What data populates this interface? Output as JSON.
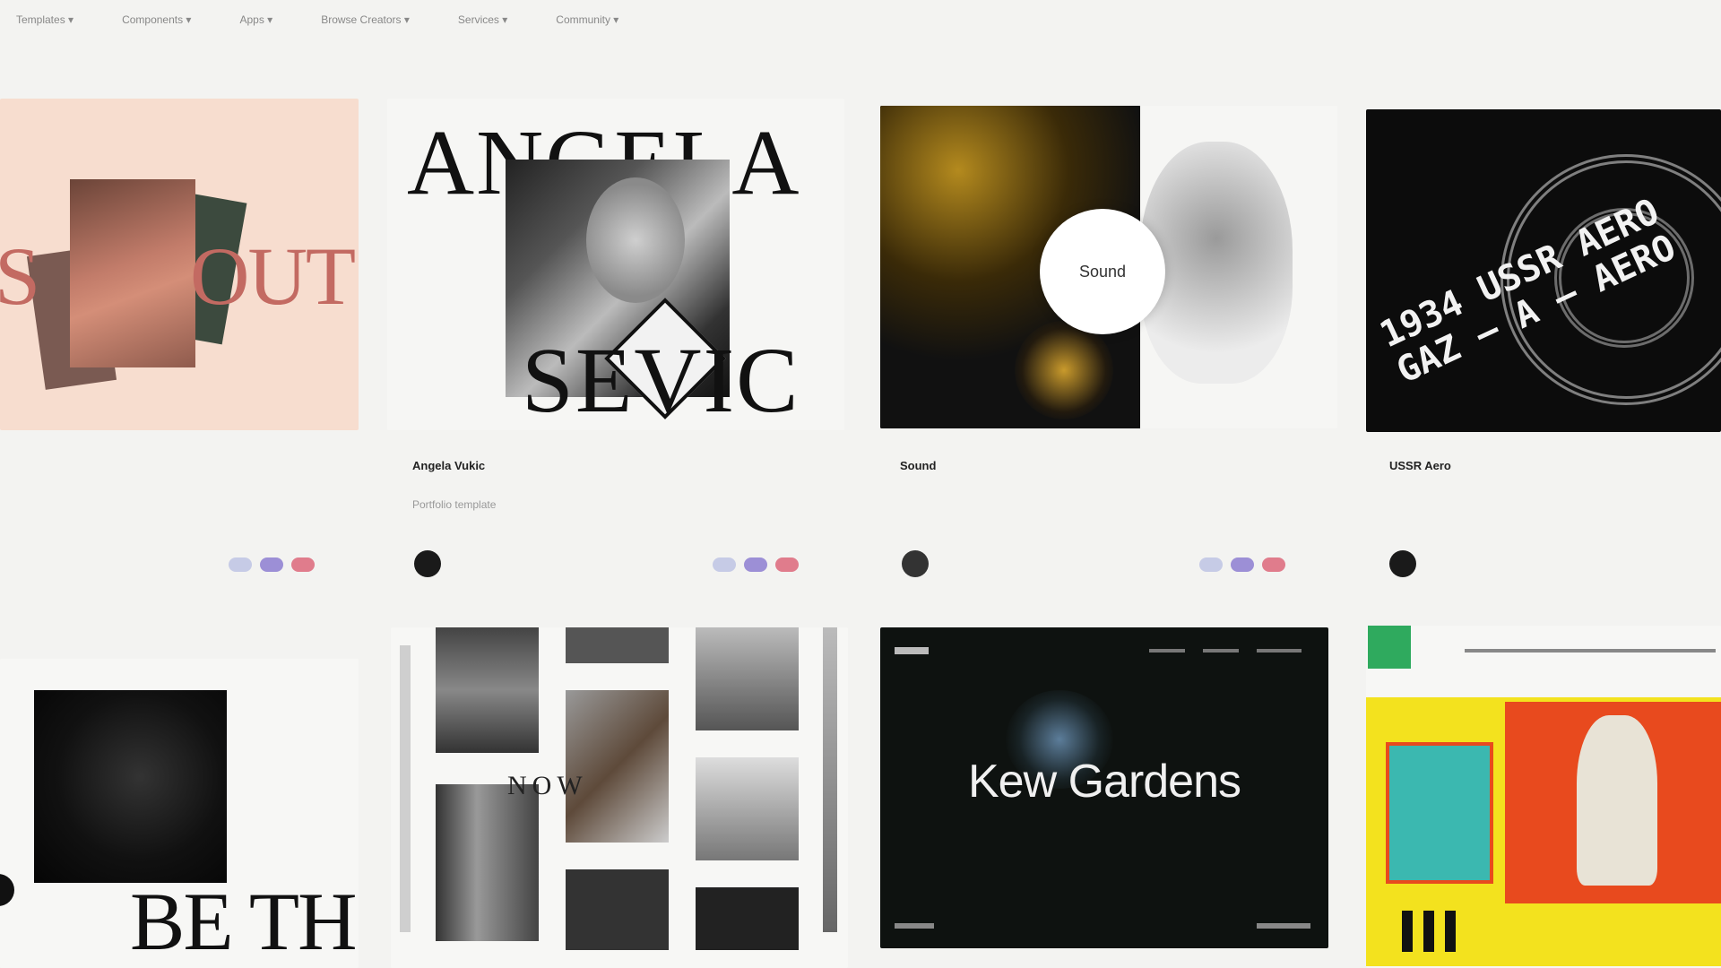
{
  "nav": {
    "items": [
      "Templates ▾",
      "Components ▾",
      "Apps ▾",
      "Browse Creators ▾",
      "Services ▾",
      "Community ▾"
    ]
  },
  "cards": [
    {
      "title": "",
      "subtitle": "",
      "price": "",
      "author": "",
      "art_text": "OUT",
      "art_text_left": "S"
    },
    {
      "title": "Angela Vukic",
      "subtitle": "Portfolio template",
      "price": "",
      "author": "",
      "art_text_top": "ANGELA",
      "art_text_bottom": "SEVIC"
    },
    {
      "title": "Sound",
      "subtitle": "",
      "price": "",
      "author": "",
      "badge": "Sound"
    },
    {
      "title": "USSR Aero",
      "subtitle": "",
      "price": "",
      "author": "",
      "art_text": "1934 USSR AERO GAZ — A — AERO"
    },
    {
      "art_text": "BE TH"
    },
    {
      "art_text": "NOW"
    },
    {
      "art_text": "Kew Gardens"
    },
    {
      "art_text": ""
    }
  ],
  "colors": {
    "background": "#f3f3f1",
    "pill_a": "#c6cbe6",
    "pill_b": "#9c8fd6",
    "pill_c": "#e07c8c",
    "kew_bg": "#0e1210",
    "poster_yellow": "#f3e21e",
    "poster_red": "#e84a1e",
    "poster_teal": "#3bb8b0",
    "poster_green": "#2faa5e"
  }
}
